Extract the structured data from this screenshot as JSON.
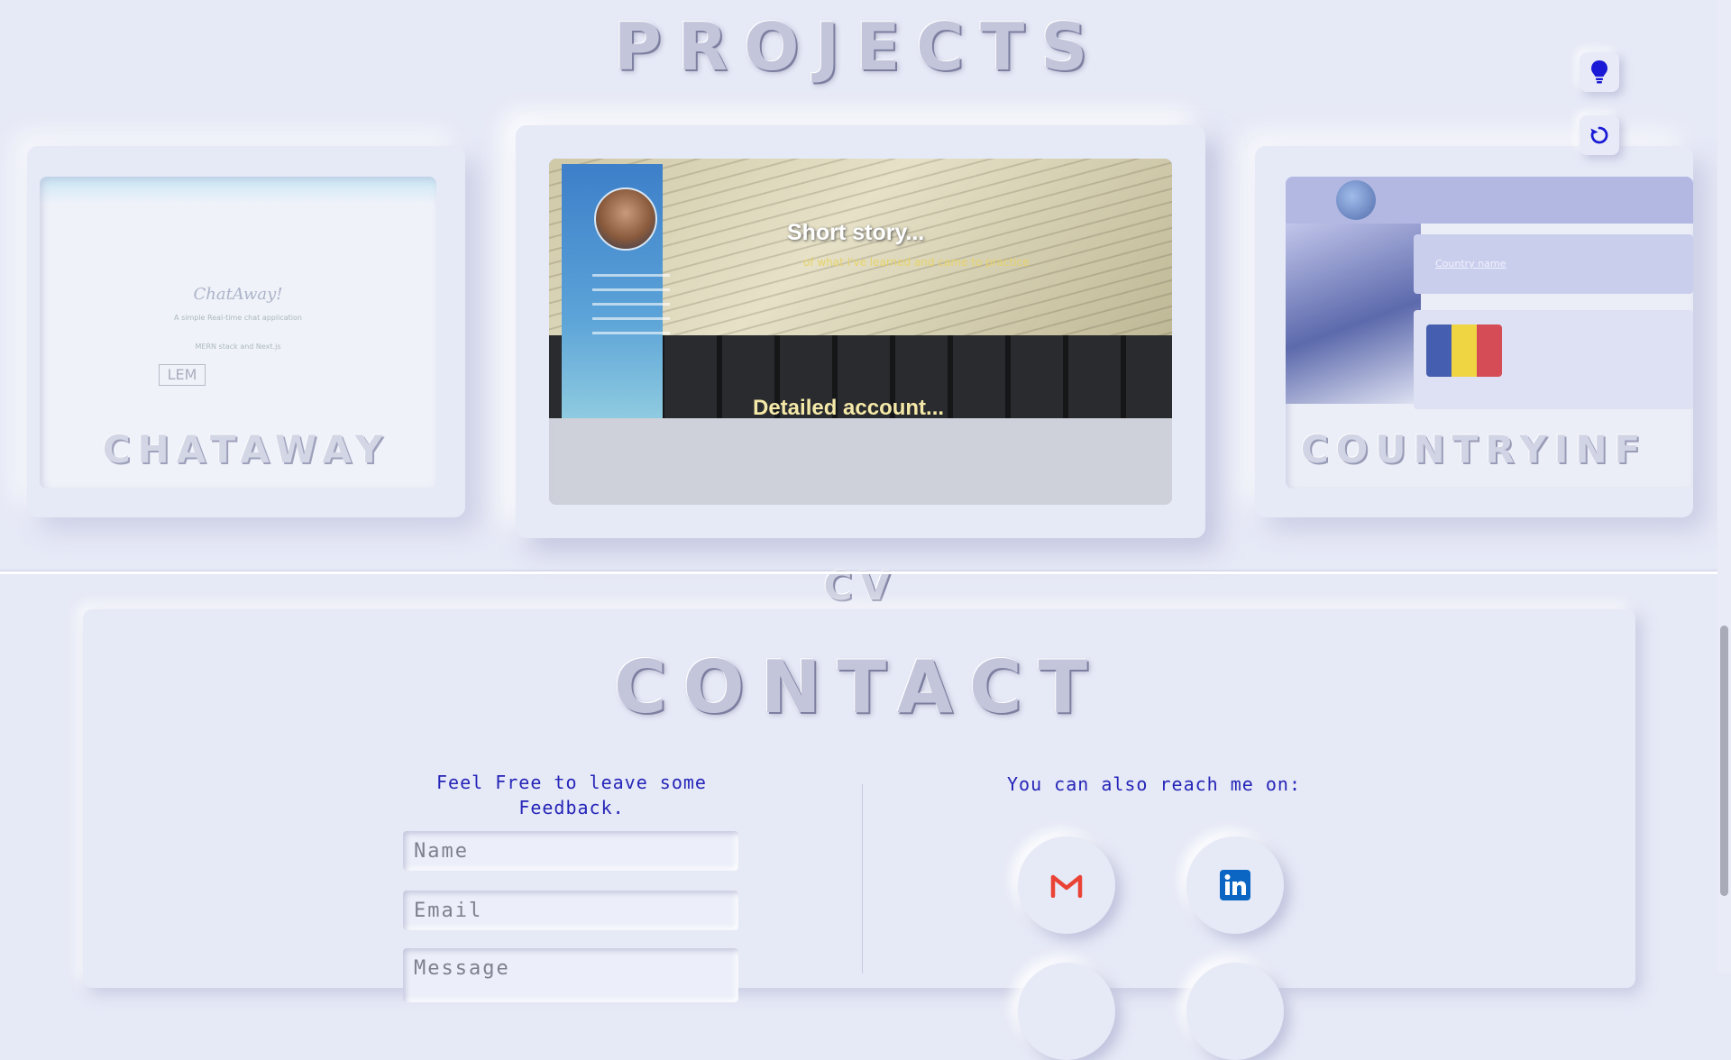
{
  "sections": {
    "projects_title": "PROJECTS",
    "contact_title": "CONTACT"
  },
  "projects": [
    {
      "label": "CHATAWAY",
      "preview": {
        "logo": "ChatAway!",
        "lines": [
          "A simple Real-time chat application",
          "MERN stack and Next.js"
        ],
        "badge": "LEM"
      }
    },
    {
      "label": "CV",
      "preview": {
        "headline": "Short story...",
        "subline": "of what I've learned and came to practice",
        "detail": "Detailed account..."
      }
    },
    {
      "label": "COUNTRYINF",
      "preview": {
        "search_placeholder": "Country name",
        "flag_colors": [
          "#1f3c9e",
          "#f3d117",
          "#d22630"
        ]
      }
    }
  ],
  "controls": {
    "theme_icon": "lightbulb-icon",
    "reset_icon": "reset-icon",
    "accent": "#1a1ad6"
  },
  "contact": {
    "feedback_text": "Feel Free to leave some Feedback.",
    "reach_text": "You can also reach me on:",
    "form": {
      "name_placeholder": "Name",
      "email_placeholder": "Email",
      "message_placeholder": "Message"
    },
    "socials": [
      {
        "name": "Gmail",
        "icon": "gmail-icon",
        "color": "#ea4335"
      },
      {
        "name": "LinkedIn",
        "icon": "linkedin-icon",
        "color": "#0a66c2"
      }
    ]
  }
}
